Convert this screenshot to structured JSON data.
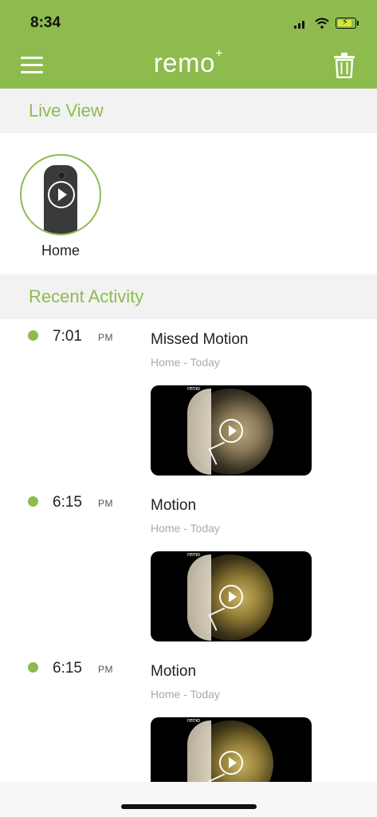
{
  "status_bar": {
    "time": "8:34"
  },
  "header": {
    "logo": "remo",
    "logo_sup": "+"
  },
  "live_view": {
    "section_title": "Live View",
    "cameras": [
      {
        "label": "Home"
      }
    ]
  },
  "recent_activity": {
    "section_title": "Recent Activity",
    "items": [
      {
        "time": "7:01",
        "period": "PM",
        "title": "Missed Motion",
        "subtitle": "Home - Today",
        "thumb_brand": "remo"
      },
      {
        "time": "6:15",
        "period": "PM",
        "title": "Motion",
        "subtitle": "Home - Today",
        "thumb_brand": "remo"
      },
      {
        "time": "6:15",
        "period": "PM",
        "title": "Motion",
        "subtitle": "Home - Today",
        "thumb_brand": "remo"
      }
    ]
  },
  "colors": {
    "accent": "#8dbb4e",
    "section_bg": "#f2f2f2"
  },
  "icons": {
    "menu": "hamburger-menu-icon",
    "delete": "trash-icon",
    "play": "play-icon"
  }
}
